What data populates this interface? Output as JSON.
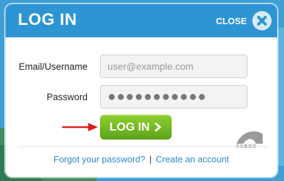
{
  "modal": {
    "title": "LOG IN",
    "close_label": "CLOSE"
  },
  "form": {
    "email_label": "Email/Username",
    "email_placeholder": "user@example.com",
    "password_label": "Password",
    "password_value": "●●●●●●●●●●●"
  },
  "login_button": {
    "label": "LOG IN"
  },
  "logo": {
    "text": "AABOX"
  },
  "footer": {
    "forgot_link": "Forgot your password?",
    "separator": "|",
    "create_link": "Create an account"
  },
  "colors": {
    "header": "#2d95d3",
    "button": "#6fb822",
    "link": "#2b88c8",
    "arrow": "#e01b1b"
  }
}
